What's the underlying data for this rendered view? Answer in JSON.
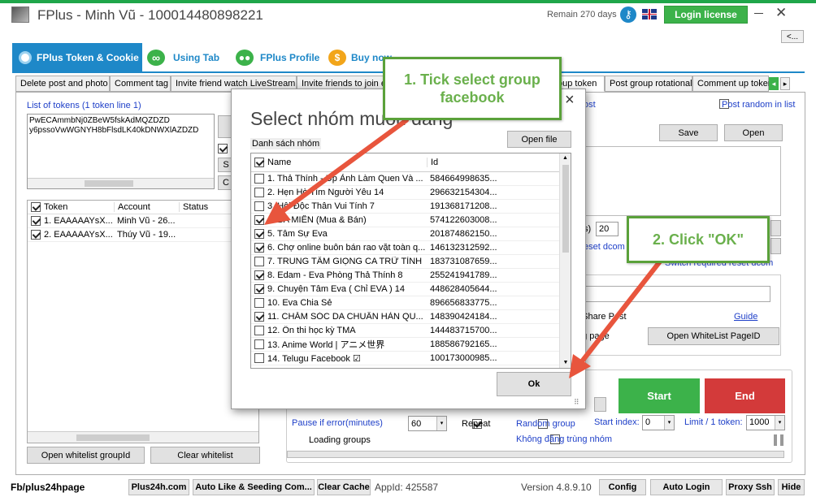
{
  "window": {
    "title": "FPlus - Minh Vũ - 100014480898221",
    "remain": "Remain 270 days",
    "login_license": "Login license",
    "collapse": "<..."
  },
  "main_tabs": [
    {
      "label": "FPlus Token & Cookie"
    },
    {
      "label": "Using Tab"
    },
    {
      "label": "FPlus Profile"
    },
    {
      "label": "Buy now"
    }
  ],
  "sub_tabs": [
    "Delete post and photo",
    "Comment tag",
    "Invite friend watch LiveStream",
    "Invite friends to join e",
    "oup token",
    "Post group rotational",
    "Comment up token"
  ],
  "left": {
    "tokens_label": "List of tokens (1 token line 1)",
    "tokens_text": "PwECAmmbNj0ZBeW5fskAdMQZDZD\ny6pssoVwWGNYH8bFlsdLK40kDNWXlAZDZD",
    "columns": [
      "Token",
      "Account",
      "Status"
    ],
    "rows": [
      {
        "token": "1. EAAAAAYsX...",
        "account": "Minh Vũ - 26..."
      },
      {
        "token": "2. EAAAAAYsX...",
        "account": "Thúy Vũ - 19..."
      }
    ],
    "open_whitelist": "Open whitelist groupId",
    "clear_whitelist": "Clear whitelist"
  },
  "right": {
    "post_label": "ost",
    "post_random": "Post random in list",
    "save": "Save",
    "open": "Open",
    "delay_value": "20",
    "reset_dcom": "eset dcom",
    "switch_reset": "Switch required reset dcom",
    "share_post": "e Share Post",
    "guide": "Guide",
    "page_label": "ng page",
    "open_whitelist_page": "Open WhiteList PageID",
    "start": "Start",
    "end": "End",
    "pause_label": "Pause if error(minutes)",
    "pause_value": "60",
    "repeat": "Repeat",
    "random_group": "Random group",
    "start_index_label": "Start index:",
    "start_index_value": "0",
    "limit_label": "Limit / 1 token:",
    "limit_value": "1000",
    "no_duplicate": "Không đăng trùng nhóm",
    "loading": "Loading groups"
  },
  "dialog": {
    "title": "Select nhóm muốn đăng",
    "close": "×",
    "list_label": "Danh sách nhóm",
    "open_file": "Open file",
    "columns": [
      "Name",
      "Id"
    ],
    "rows": [
      {
        "name": "1. Thả Thính - Up Ảnh Làm Quen Và ...",
        "id": "584664998635...",
        "checked": false
      },
      {
        "name": "2. Hẹn Hò Tìm Người Yêu 14",
        "id": "296632154304...",
        "checked": false
      },
      {
        "name": "3. Hội Độc Thân Vui Tính 7",
        "id": "191368171208...",
        "checked": false
      },
      {
        "name": "4. BA MIỀN (Mua & Bán)",
        "id": "574122603008...",
        "checked": true
      },
      {
        "name": "5. Tâm Sự Eva",
        "id": "201874862150...",
        "checked": true
      },
      {
        "name": "6. Chợ online buôn bán rao vặt toàn q...",
        "id": "146132312592...",
        "checked": true
      },
      {
        "name": "7. TRUNG TÂM GIỌNG CA TRỮ TÌNH",
        "id": "183731087659...",
        "checked": false
      },
      {
        "name": "8. Edam - Eva Phòng Thả Thính 8",
        "id": "255241941789...",
        "checked": true
      },
      {
        "name": "9. Chuyện Tâm Eva ( Chỉ EVA ) 14",
        "id": "448628405644...",
        "checked": true
      },
      {
        "name": "10. Eva Chia Sẻ",
        "id": "896656833775...",
        "checked": false
      },
      {
        "name": "11. CHĂM SÓC DA CHUẨN HÀN QU...",
        "id": "148390424184...",
        "checked": true
      },
      {
        "name": "12. Ôn thi học kỳ TMA",
        "id": "144483715700...",
        "checked": false
      },
      {
        "name": "13. Anime World | アニメ世界",
        "id": "188586792165...",
        "checked": false
      },
      {
        "name": "14. Telugu Facebook ☑",
        "id": "100173000985...",
        "checked": false
      }
    ],
    "ok": "Ok"
  },
  "callouts": {
    "one": "1. Tick select group facebook",
    "two": "2. Click \"OK\""
  },
  "status_bar": {
    "fb": "Fb/plus24hpage",
    "plus24h": "Plus24h.com",
    "auto_like": "Auto Like & Seeding Com...",
    "clear_cache": "Clear Cache",
    "appid": "AppId: 425587",
    "version": "Version 4.8.9.10",
    "config": "Config",
    "auto_login": "Auto Login",
    "proxy": "Proxy Ssh",
    "hide": "Hide"
  },
  "colors": {
    "accent": "#1e88c8",
    "green": "#3cb24a",
    "red": "#d33a3a",
    "arrow": "#e8553d",
    "callout": "#5aa13a"
  }
}
